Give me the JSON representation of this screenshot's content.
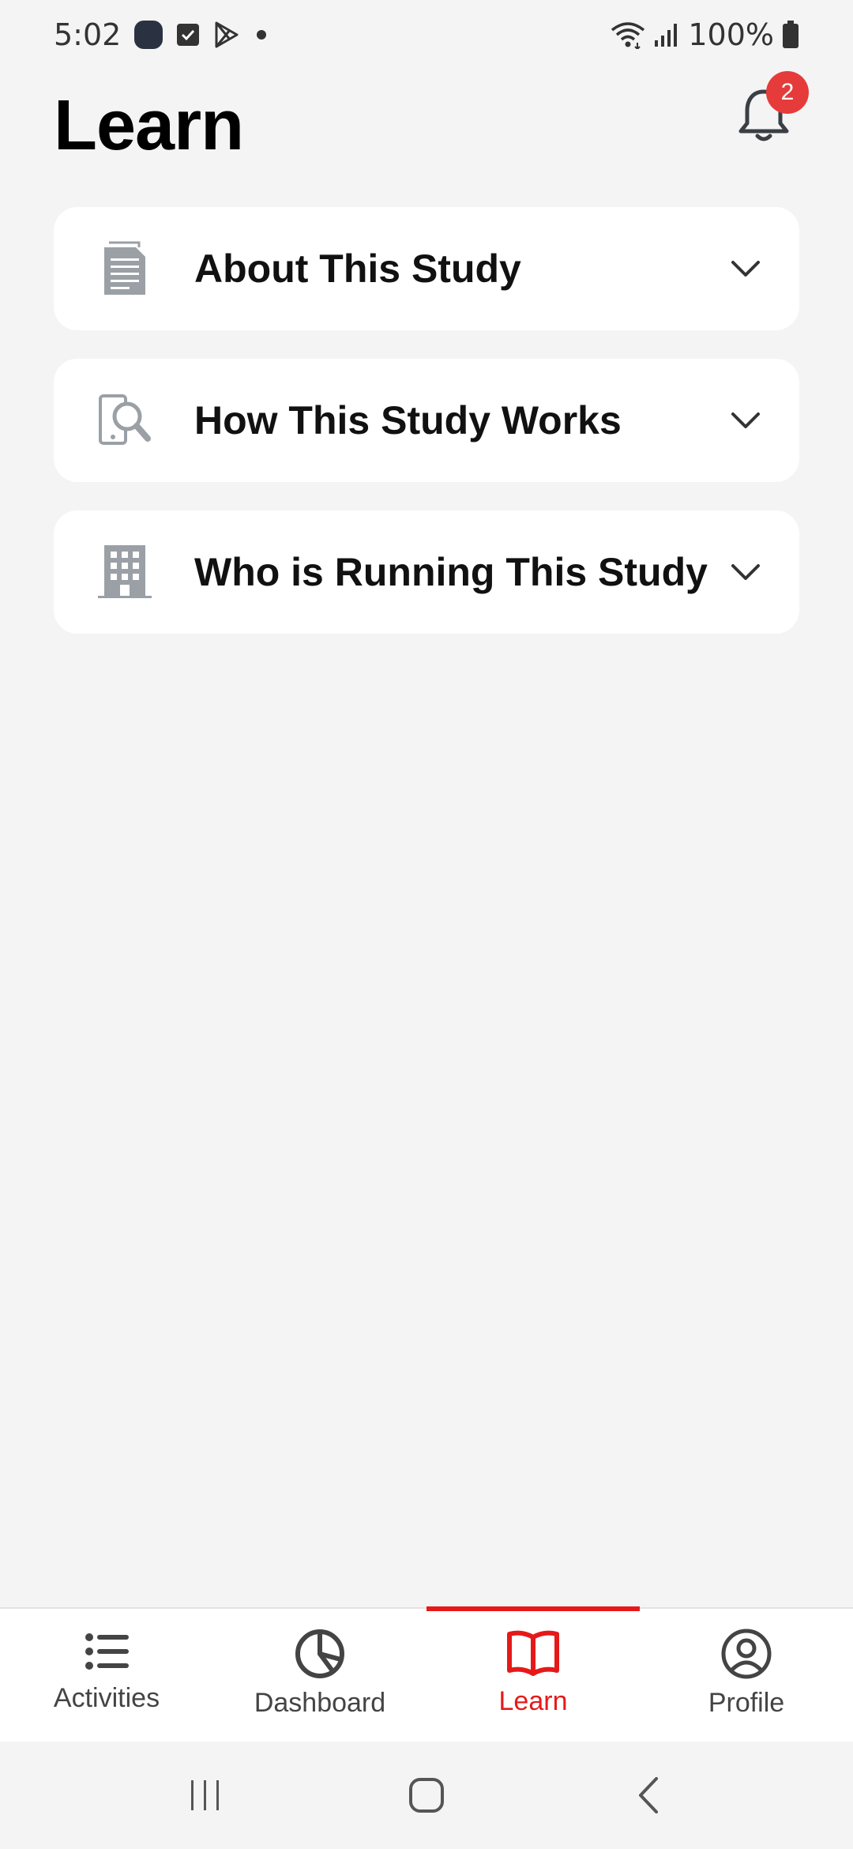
{
  "status_bar": {
    "time": "5:02",
    "battery": "100%",
    "icons": [
      "app-icon",
      "checkbox-icon",
      "play-store-icon",
      "dot-icon",
      "wifi-icon",
      "signal-icon",
      "battery-icon"
    ]
  },
  "header": {
    "title": "Learn",
    "notification_count": "2"
  },
  "accordion": {
    "items": [
      {
        "label": "About This Study",
        "icon": "document-icon"
      },
      {
        "label": "How This Study Works",
        "icon": "phone-search-icon"
      },
      {
        "label": "Who is Running This Study",
        "icon": "building-icon"
      }
    ]
  },
  "bottom_nav": {
    "items": [
      {
        "label": "Activities",
        "icon": "list-icon",
        "active": false
      },
      {
        "label": "Dashboard",
        "icon": "pie-chart-icon",
        "active": false
      },
      {
        "label": "Learn",
        "icon": "book-icon",
        "active": true
      },
      {
        "label": "Profile",
        "icon": "user-circle-icon",
        "active": false
      }
    ]
  },
  "colors": {
    "accent": "#e61919",
    "badge": "#e53b3b",
    "background": "#f4f4f5",
    "card": "#ffffff",
    "icon_gray": "#9aa0a6"
  }
}
